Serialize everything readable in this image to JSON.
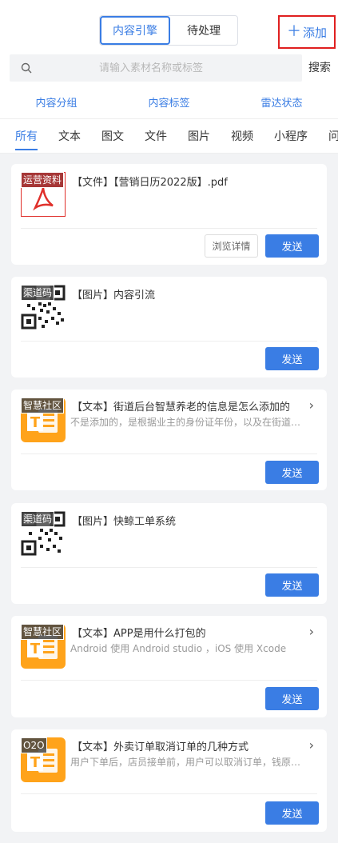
{
  "header": {
    "segments": [
      "内容引擎",
      "待处理"
    ],
    "active_segment": 0,
    "add_label": "添加"
  },
  "search": {
    "placeholder": "请输入素材名称或标签",
    "button_label": "搜索"
  },
  "filters": [
    "内容分组",
    "内容标签",
    "雷达状态"
  ],
  "tabs": [
    "所有",
    "文本",
    "图文",
    "文件",
    "图片",
    "视频",
    "小程序",
    "问答"
  ],
  "active_tab": 0,
  "actions": {
    "send_label": "发送",
    "detail_label": "浏览详情"
  },
  "cards": [
    {
      "type": "file",
      "badge": "运营资料",
      "title": "【文件】【营销日历2022版】.pdf",
      "desc": "",
      "thumb": "pdf-icon"
    },
    {
      "type": "image",
      "badge": "渠道码",
      "title": "【图片】内容引流",
      "desc": "",
      "thumb": "qrcode-icon"
    },
    {
      "type": "text",
      "badge": "智慧社区",
      "title": "【文本】街道后台智慧养老的信息是怎么添加的",
      "desc": "不是添加的，是根据业主的身份证年份，以及在街道后台录入",
      "thumb": "text-doc-icon"
    },
    {
      "type": "image",
      "badge": "渠道码",
      "title": "【图片】快鲸工单系统",
      "desc": "",
      "thumb": "qrcode-icon"
    },
    {
      "type": "text",
      "badge": "智慧社区",
      "title": "【文本】APP是用什么打包的",
      "desc": "Android 使用 Android studio ，iOS 使用 Xcode",
      "thumb": "text-doc-icon"
    },
    {
      "type": "text",
      "badge": "O2O",
      "title": "【文本】外卖订单取消订单的几种方式",
      "desc": "用户下单后，店员接单前，用户可以取消订单，钱原路退回",
      "thumb": "text-doc-icon"
    }
  ],
  "colors": {
    "accent": "#3a7de4",
    "highlight_border": "#e02020",
    "text_icon_bg": "#ffa31a",
    "pdf_red": "#e0302b"
  }
}
